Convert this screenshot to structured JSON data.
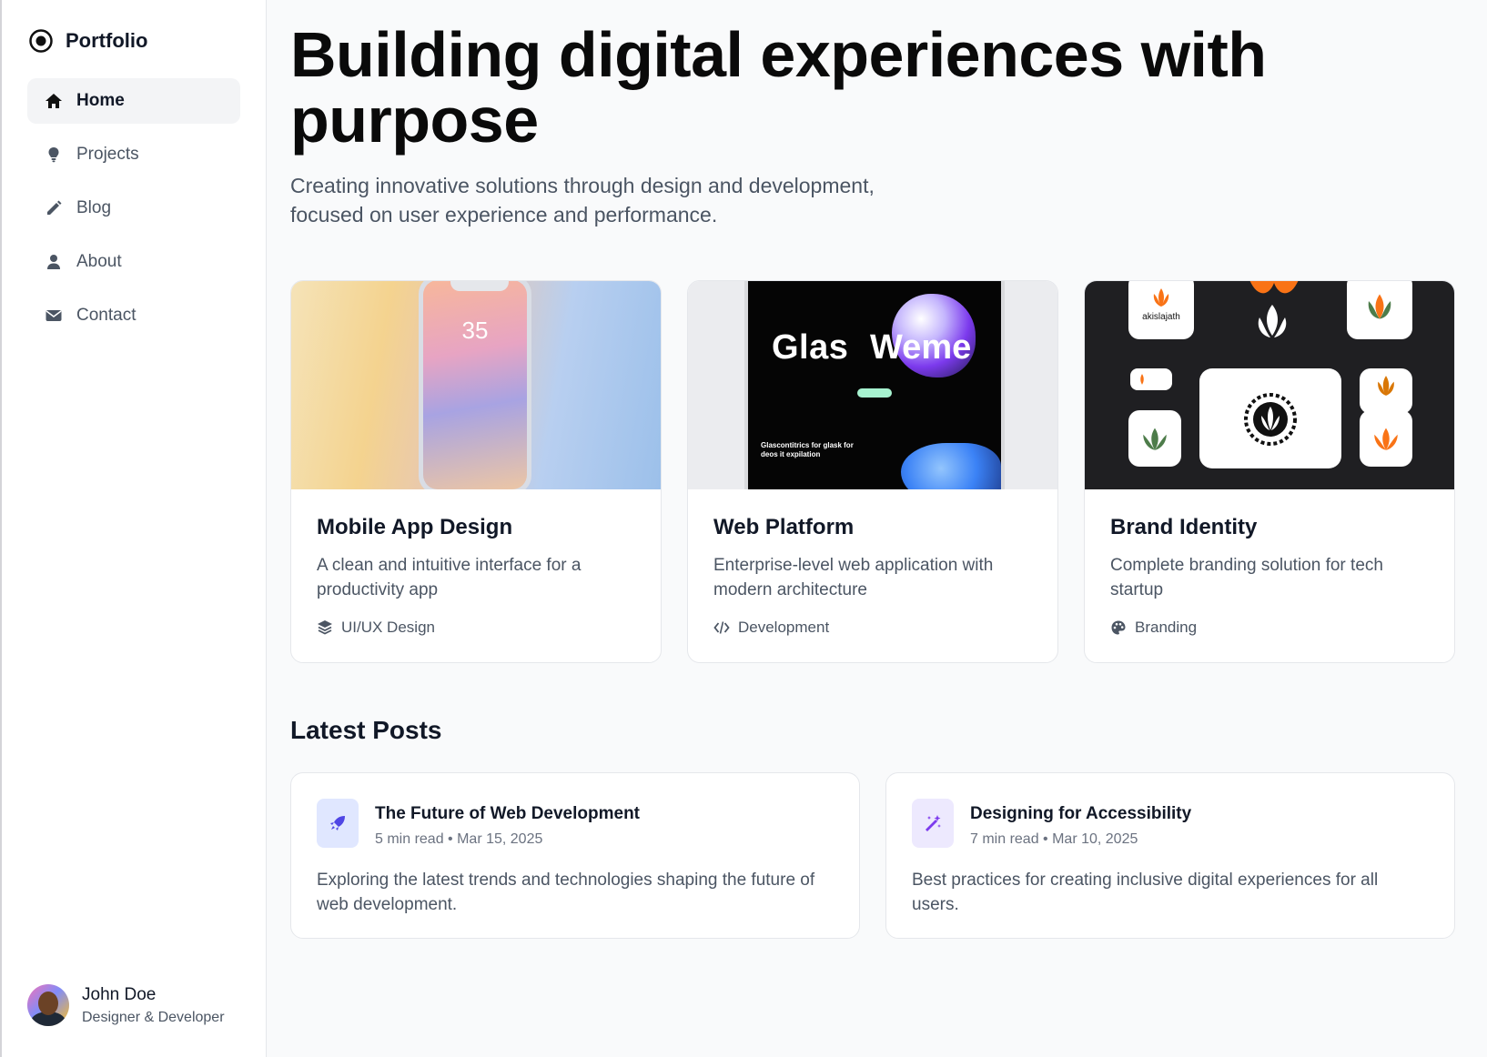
{
  "sidebar": {
    "brand": "Portfolio",
    "nav": [
      {
        "label": "Home",
        "icon": "home-icon",
        "active": true
      },
      {
        "label": "Projects",
        "icon": "lightbulb-icon"
      },
      {
        "label": "Blog",
        "icon": "pencil-icon"
      },
      {
        "label": "About",
        "icon": "user-icon"
      },
      {
        "label": "Contact",
        "icon": "envelope-icon"
      }
    ],
    "profile": {
      "name": "John Doe",
      "role": "Designer & Developer"
    }
  },
  "hero": {
    "title": "Building digital experiences with purpose",
    "subtitle": "Creating innovative solutions through design and development, focused on user experience and performance."
  },
  "projects": [
    {
      "title": "Mobile App Design",
      "description": "A clean and intuitive interface for a productivity app",
      "tag": "UI/UX Design",
      "tag_icon": "layers-icon",
      "thumb": {
        "time": "35"
      }
    },
    {
      "title": "Web Platform",
      "description": "Enterprise-level web application with modern architecture",
      "tag": "Development",
      "tag_icon": "code-icon",
      "thumb": {
        "headline_left": "Glas",
        "headline_right": "Weme",
        "caption": "Glascontitrics for glask for deos it expilation"
      }
    },
    {
      "title": "Brand Identity",
      "description": "Complete branding solution for tech startup",
      "tag": "Branding",
      "tag_icon": "palette-icon",
      "thumb": {
        "logo_text": "akislajath"
      }
    }
  ],
  "posts_section": {
    "title": "Latest Posts"
  },
  "posts": [
    {
      "title": "The Future of Web Development",
      "meta": "5 min read • Mar 15, 2025",
      "excerpt": "Exploring the latest trends and technologies shaping the future of web development.",
      "icon": "rocket-icon",
      "icon_bg": "#e0e7ff",
      "icon_color": "#4f46e5"
    },
    {
      "title": "Designing for Accessibility",
      "meta": "7 min read • Mar 10, 2025",
      "excerpt": "Best practices for creating inclusive digital experiences for all users.",
      "icon": "magic-wand-icon",
      "icon_bg": "#ede9fe",
      "icon_color": "#7c3aed"
    }
  ],
  "colors": {
    "accent_orange": "#f97316",
    "accent_green": "#4d7c4a",
    "text_dark": "#111827",
    "text_muted": "#4b5563"
  }
}
